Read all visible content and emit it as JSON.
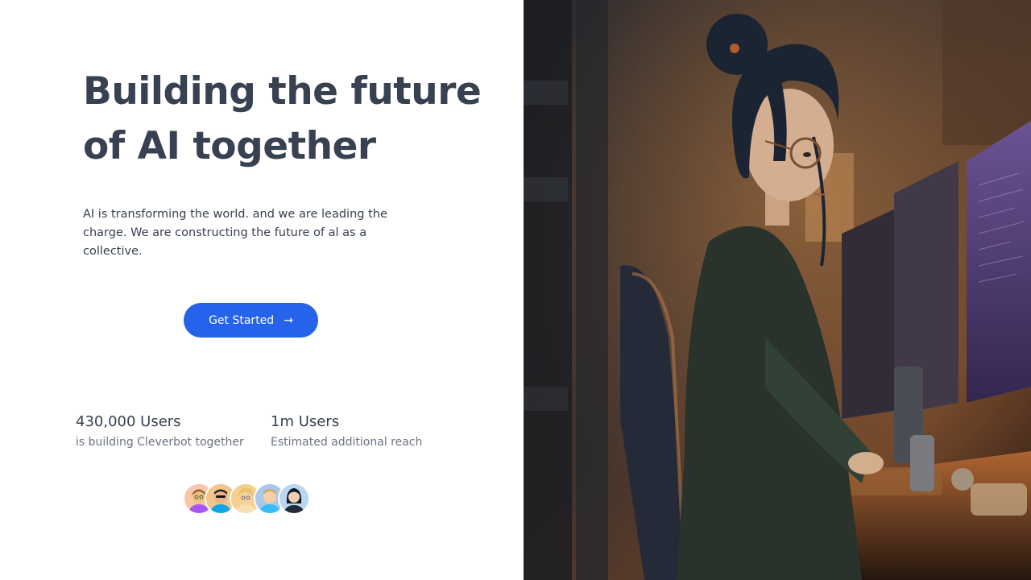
{
  "hero": {
    "title": "Building the future of AI together",
    "description": "AI is transforming the world. and we are leading the charge. We are constructing the future of al as a collective."
  },
  "cta": {
    "label": "Get Started",
    "icon": "arrow-right-icon"
  },
  "stats": [
    {
      "value": "430,000 Users",
      "label": "is building Cleverbot together"
    },
    {
      "value": "1m Users",
      "label": "Estimated additional reach"
    }
  ],
  "avatars": [
    {
      "name": "avatar-1",
      "bg": "#f9c6a7"
    },
    {
      "name": "avatar-2",
      "bg": "#f4c48e"
    },
    {
      "name": "avatar-3",
      "bg": "#f7cf8c"
    },
    {
      "name": "avatar-4",
      "bg": "#a9c9ea"
    },
    {
      "name": "avatar-5",
      "bg": "#b9d6f2"
    }
  ],
  "hero_image": {
    "description_icon": "illustration-girl-at-computer"
  },
  "colors": {
    "accent": "#2563eb",
    "heading": "#374151",
    "muted": "#6b7280"
  }
}
